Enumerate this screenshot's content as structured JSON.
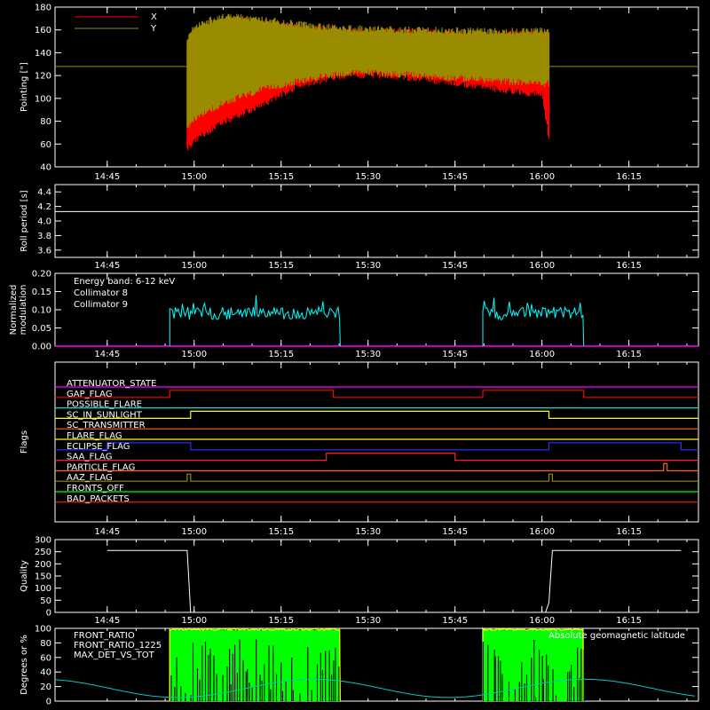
{
  "chart_data": [
    {
      "type": "line",
      "name": "pointing",
      "ylabel": "Pointing [\"]",
      "ylim": [
        40,
        180
      ],
      "yticks": [
        "40",
        "60",
        "80",
        "100",
        "120",
        "140",
        "160",
        "180"
      ],
      "xticks": [
        "14:45",
        "15:00",
        "15:15",
        "15:30",
        "15:45",
        "16:00",
        "16:15"
      ],
      "legend_position": "top-left",
      "series": [
        {
          "name": "X",
          "color": "#ff0000",
          "envelope": {
            "t": [
              14.98,
              15.0,
              15.05,
              15.1,
              15.2,
              15.3,
              15.4,
              15.5,
              15.6,
              15.7,
              15.8,
              15.9,
              16.0,
              16.02
            ],
            "lo": [
              52,
              60,
              70,
              78,
              92,
              108,
              115,
              118,
              116,
              112,
              108,
              104,
              100,
              62
            ],
            "hi": [
              150,
              160,
              168,
              172,
              170,
              165,
              163,
              162,
              162,
              161,
              160,
              160,
              160,
              158
            ]
          }
        },
        {
          "name": "Y",
          "color": "#9a8c00",
          "envelope": {
            "t": [
              14.98,
              15.0,
              15.05,
              15.1,
              15.2,
              15.3,
              15.4,
              15.5,
              15.6,
              15.7,
              15.8,
              15.9,
              16.0,
              16.02
            ],
            "lo": [
              70,
              78,
              88,
              95,
              105,
              112,
              118,
              120,
              118,
              116,
              114,
              112,
              110,
              110
            ],
            "hi": [
              155,
              165,
              172,
              175,
              172,
              168,
              165,
              164,
              163,
              163,
              162,
              162,
              162,
              162
            ]
          }
        },
        {
          "name": "baseline",
          "color": "#9a8c00",
          "value": 128
        }
      ]
    },
    {
      "type": "line",
      "name": "roll",
      "ylabel": "Roll period [s]",
      "ylim": [
        3.5,
        4.5
      ],
      "yticks": [
        "3.6",
        "3.8",
        "4.0",
        "4.2",
        "4.4"
      ],
      "xticks": [
        "14:45",
        "15:00",
        "15:15",
        "15:30",
        "15:45",
        "16:00",
        "16:15"
      ],
      "series": [
        {
          "color": "#ffffff",
          "value": 4.13
        }
      ]
    },
    {
      "type": "line",
      "name": "modulation",
      "ylabel": "Normalized modulation",
      "ylim": [
        0,
        0.2
      ],
      "yticks": [
        "0.00",
        "0.05",
        "0.10",
        "0.15",
        "0.20"
      ],
      "xticks": [
        "14:45",
        "15:00",
        "15:15",
        "15:30",
        "15:45",
        "16:00",
        "16:15"
      ],
      "annotation": "Energy band: 6-12 keV",
      "series": [
        {
          "name": "Collimator 8",
          "color": "#00ffff",
          "segments": [
            [
              14.93,
              15.42
            ],
            [
              15.83,
              16.12
            ]
          ],
          "level": 0.09
        },
        {
          "name": "Collimator 9",
          "color": "#ff00ff",
          "value": 0
        }
      ]
    },
    {
      "type": "line",
      "name": "flags",
      "ylabel": "Flags",
      "xticks": [
        "14:45",
        "15:00",
        "15:15",
        "15:30",
        "15:45",
        "16:00",
        "16:15"
      ],
      "series": [
        {
          "name": "ATTENUATOR_STATE",
          "color": "#ff00ff",
          "steps": []
        },
        {
          "name": "GAP_FLAG",
          "color": "#ff0000",
          "steps": [
            [
              14.93,
              15.4
            ],
            [
              15.83,
              16.12
            ]
          ]
        },
        {
          "name": "POSSIBLE_FLARE",
          "color": "#00e0e0",
          "steps": []
        },
        {
          "name": "SC_IN_SUNLIGHT",
          "color": "#ffff00",
          "steps": [
            [
              14.99,
              16.02
            ]
          ]
        },
        {
          "name": "SC_TRANSMITTER",
          "color": "#ff6020",
          "steps": []
        },
        {
          "name": "FLARE_FLAG",
          "color": "#ffff00",
          "steps": []
        },
        {
          "name": "ECLIPSE_FLAG",
          "color": "#3030ff",
          "steps": [
            [
              14.75,
              14.99
            ],
            [
              16.02,
              16.4
            ]
          ]
        },
        {
          "name": "SAA_FLAG",
          "color": "#ff2020",
          "steps": [
            [
              15.38,
              15.75
            ]
          ]
        },
        {
          "name": "PARTICLE_FLAG",
          "color": "#ff6020",
          "steps": [
            [
              16.35,
              16.36
            ]
          ]
        },
        {
          "name": "AAZ_FLAG",
          "color": "#9a8c00",
          "steps": [
            [
              14.98,
              14.99
            ],
            [
              16.02,
              16.03
            ]
          ]
        },
        {
          "name": "FRONTS_OFF",
          "color": "#00ff00",
          "steps": []
        },
        {
          "name": "BAD_PACKETS",
          "color": "#ff2020",
          "steps": []
        }
      ]
    },
    {
      "type": "line",
      "name": "quality",
      "ylabel": "Quality",
      "ylim": [
        0,
        300
      ],
      "yticks": [
        "0",
        "50",
        "100",
        "150",
        "200",
        "250",
        "300"
      ],
      "xticks": [
        "14:45",
        "15:00",
        "15:15",
        "15:30",
        "15:45",
        "16:00",
        "16:15"
      ],
      "series": [
        {
          "color": "#ffffff",
          "points": [
            [
              14.75,
              255
            ],
            [
              14.98,
              255
            ],
            [
              14.99,
              0
            ],
            [
              16.01,
              0
            ],
            [
              16.02,
              40
            ],
            [
              16.03,
              255
            ],
            [
              16.4,
              255
            ]
          ]
        }
      ]
    },
    {
      "type": "line",
      "name": "ratios",
      "ylabel": "Degrees or %",
      "ylim": [
        0,
        100
      ],
      "yticks": [
        "0",
        "20",
        "40",
        "60",
        "80",
        "100"
      ],
      "annotation": "Absolute geomagnetic latitude",
      "series": [
        {
          "name": "FRONT_RATIO",
          "color": "#ffff00",
          "segments": [
            [
              14.93,
              15.42
            ],
            [
              15.83,
              16.12
            ]
          ],
          "level": 100
        },
        {
          "name": "FRONT_RATIO_1225",
          "color": "#00ff00",
          "segments": [
            [
              14.93,
              15.42
            ],
            [
              15.83,
              16.12
            ]
          ],
          "level": 95
        },
        {
          "name": "MAX_DET_VS_TOT",
          "color": "#ff9900",
          "steps": []
        },
        {
          "name": "geomagnetic",
          "color": "#00c8c8",
          "range": [
            5,
            30
          ]
        }
      ]
    }
  ]
}
